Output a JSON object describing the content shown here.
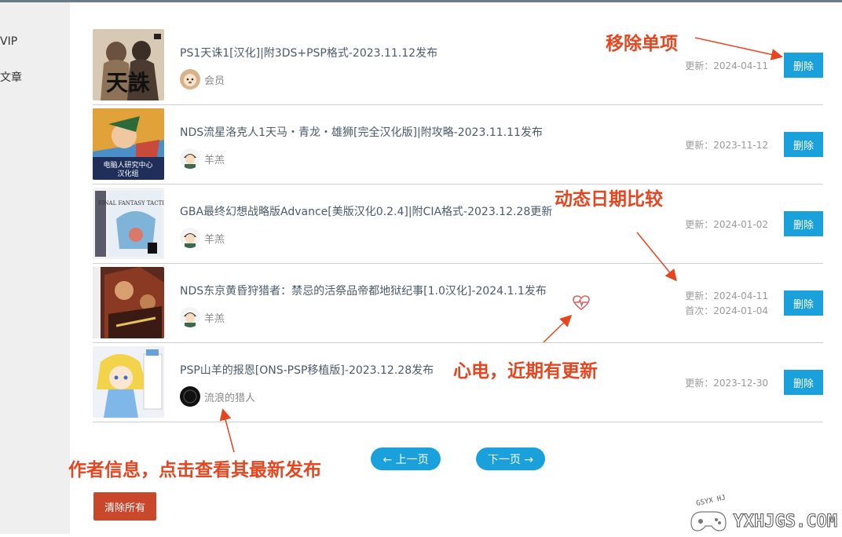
{
  "sidebar": {
    "items": [
      {
        "label": "VIP"
      },
      {
        "label": "文章"
      }
    ]
  },
  "rows": [
    {
      "title": "PS1天诛1[汉化]|附3DS+PSP格式-2023.11.12发布",
      "author": "会员",
      "date_lines": [
        "更新：2024-04-11"
      ],
      "delete_label": "删除",
      "thumb_text": "天誅"
    },
    {
      "title": "NDS流星洛克人1天马・青龙・雄狮[完全汉化版]|附攻略-2023.11.11发布",
      "author": "羊羔",
      "date_lines": [
        "更新：2023-11-12"
      ],
      "delete_label": "删除",
      "thumb_text": "电脑人研究中心 汉化组"
    },
    {
      "title": "GBA最终幻想战略版Advance[美版汉化0.2.4]|附CIA格式-2023.12.28更新",
      "author": "羊羔",
      "date_lines": [
        "更新：2024-01-02"
      ],
      "delete_label": "删除",
      "thumb_text": "FINAL FANTASY TACTICS"
    },
    {
      "title": "NDS东京黄昏狩猎者：禁忌的活祭品帝都地狱纪事[1.0汉化]-2024.1.1发布",
      "author": "羊羔",
      "date_lines": [
        "更新：2024-04-11",
        "首次：2024-01-04"
      ],
      "delete_label": "删除",
      "thumb_text": ""
    },
    {
      "title": "PSP山羊的报恩[ONS-PSP移植版]-2023.12.28发布",
      "author": "流浪的猎人",
      "date_lines": [
        "更新：2023-12-30"
      ],
      "delete_label": "删除",
      "thumb_text": ""
    }
  ],
  "pager": {
    "prev": "← 上一页",
    "next": "下一页 →"
  },
  "clear_all": "清除所有",
  "annotations": {
    "remove_single": "移除单项",
    "date_compare": "动态日期比较",
    "heartbeat": "心电，近期有更新",
    "author_info": "作者信息，点击查看其最新发布"
  },
  "watermark": {
    "text": "YXHJGS.COM",
    "badge": "GSYX HJ"
  },
  "colors": {
    "accent": "#1aa1dc",
    "danger": "#c9472b",
    "annotation": "#e5451f"
  }
}
